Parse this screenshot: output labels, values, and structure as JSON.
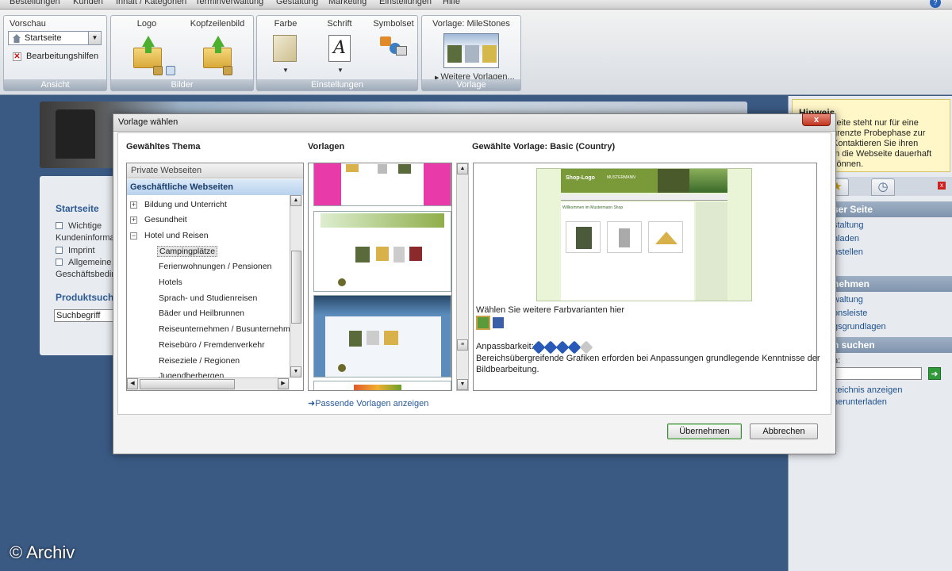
{
  "menubar": {
    "items": [
      "Bestellungen",
      "Kunden",
      "Inhalt / Kategorien",
      "Terminverwaltung",
      "Gestaltung",
      "Marketing",
      "Einstellungen",
      "Hilfe"
    ]
  },
  "ribbon": {
    "ansicht": {
      "title": "Vorschau",
      "select_value": "Startseite",
      "bearb_label": "Bearbeitungshilfen",
      "footer": "Ansicht"
    },
    "bilder": {
      "logo_label": "Logo",
      "kopf_label": "Kopfzeilenbild",
      "footer": "Bilder"
    },
    "einstellungen": {
      "farbe_label": "Farbe",
      "schrift_label": "Schrift",
      "symbolset_label": "Symbolset",
      "footer": "Einstellungen"
    },
    "vorlage": {
      "title": "Vorlage: MileStones",
      "more_label": "Weitere Vorlagen...",
      "footer": "Vorlage"
    }
  },
  "background": {
    "left": {
      "startseite_heading": "Startseite",
      "items": [
        "Wichtige",
        "Kundeninformat",
        "Imprint",
        "Allgemeine",
        "Geschäftsbedin"
      ],
      "produktsuche_heading": "Produktsuch",
      "search_value": "Suchbegriff"
    },
    "right": {
      "hinweis_title": "Hinweis",
      "hinweis_lines": [
        "seite steht nur für eine",
        "grenzte Probephase zur",
        "Kontaktieren Sie ihren",
        "m die Webseite dauerhaft",
        "können."
      ],
      "section1": "ser Seite",
      "section1_links": [
        "staltung",
        "hladen",
        "nstellen"
      ],
      "section2": "nehmen",
      "section2_links": [
        "waltung",
        "onsleiste",
        "gsgrundlagen"
      ],
      "section3": "n suchen",
      "section3_label": "h:",
      "section3_links": [
        "zeichnis anzeigen",
        "herunterladen"
      ]
    },
    "watermark": "© Archiv"
  },
  "dialog": {
    "title": "Vorlage wählen",
    "close_label": "x",
    "theme_header": "Gewähltes Thema",
    "templates_header": "Vorlagen",
    "preview_header": "Gewählte Vorlage: Basic (Country)",
    "tree": {
      "cat_private": "Private Webseiten",
      "cat_business": "Geschäftliche Webseiten",
      "nodes": [
        {
          "label": "Bildung und Unterricht",
          "expander": "+"
        },
        {
          "label": "Gesundheit",
          "expander": "+"
        },
        {
          "label": "Hotel und Reisen",
          "expander": "−"
        }
      ],
      "leaves": [
        "Campingplätze",
        "Ferienwohnungen / Pensionen",
        "Hotels",
        "Sprach- und Studienreisen",
        "Bäder und Heilbrunnen",
        "Reiseunternehmen / Busunternehmen",
        "Reisebüro / Fremdenverkehr",
        "Reiseziele / Regionen",
        "Jugendherbergen"
      ],
      "selected": "Campingplätze"
    },
    "templates_link": "Passende Vorlagen anzeigen",
    "preview": {
      "shop_logo": "Shop-Logo",
      "shop_slogan": "MUSTERMANN",
      "welcome": "Willkommen im Mustermann Shop",
      "variants_label": "Wählen Sie weitere Farbvarianten hier",
      "variant_colors": [
        "#5a9a3a",
        "#3a5fa8"
      ],
      "anpass_label": "Anpassbarkeit:",
      "anpass_rating": 4,
      "anpass_max": 5,
      "description_line1": "Bereichsübergreifende Grafiken erforden bei Anpassungen grundlegende Kenntnisse der",
      "description_line2": "Bildbearbeitung."
    },
    "ok_label": "Übernehmen",
    "cancel_label": "Abbrechen"
  }
}
